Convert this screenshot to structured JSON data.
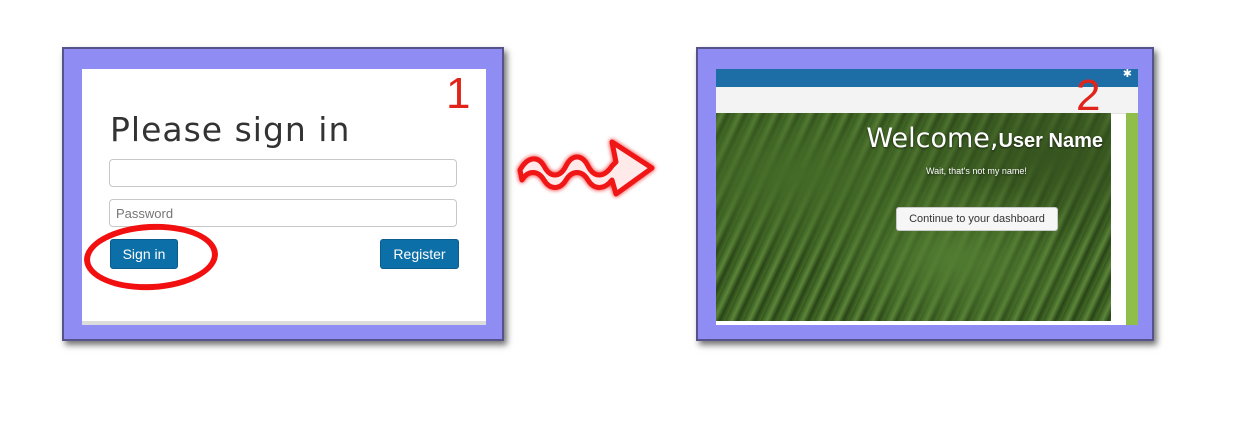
{
  "steps": {
    "first": "1",
    "second": "2"
  },
  "signin": {
    "title": "Please sign in",
    "username_value": "",
    "password_placeholder": "Password",
    "signin_label": "Sign in",
    "register_label": "Register"
  },
  "dashboard": {
    "welcome_word": "Welcome,",
    "user_name": "User Name",
    "subtitle": "Wait, that's not my name!",
    "continue_label": "Continue to your dashboard",
    "topbar_icon": "gear-icon"
  },
  "colors": {
    "frame": "#8f8cf4",
    "button_blue": "#0d6fa7",
    "highlight_red": "#f20f0f",
    "topbar_blue": "#1d6ea6",
    "accent_green": "#8fbe4a"
  }
}
